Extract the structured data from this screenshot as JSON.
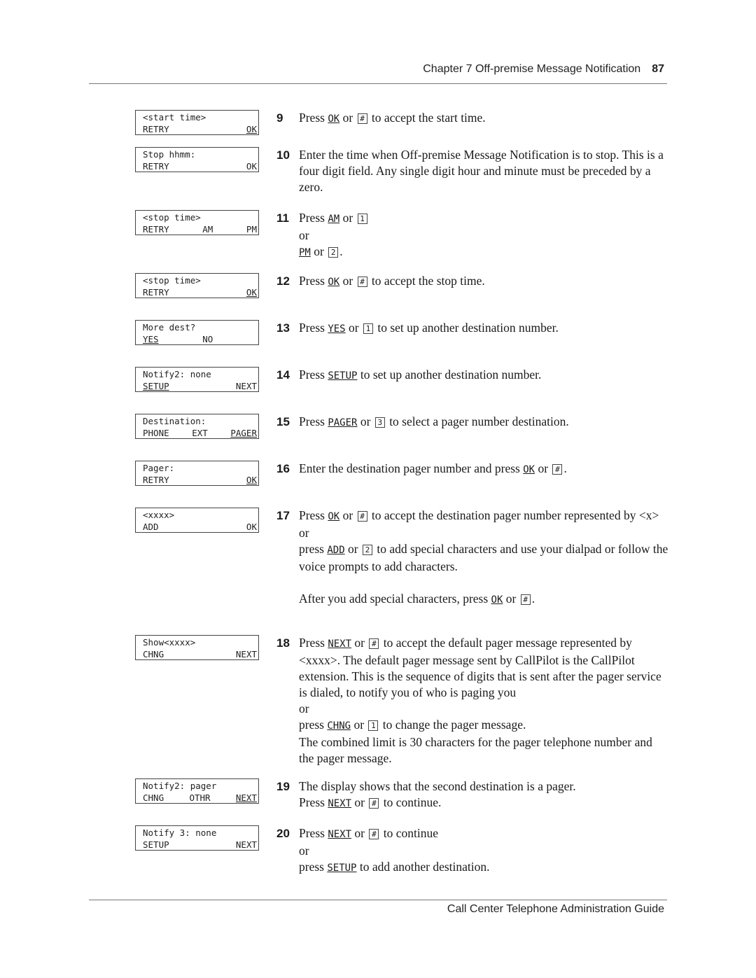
{
  "header": {
    "chapter": "Chapter 7  Off-premise Message Notification",
    "page_number": "87"
  },
  "footer": {
    "title": "Call Center Telephone Administration Guide"
  },
  "displays": [
    {
      "line1": "<start time>",
      "line2": [
        "RETRY",
        "",
        "OK"
      ],
      "underlined": [
        2
      ]
    },
    {
      "line1": "Stop hhmm:",
      "line2": [
        "RETRY",
        "",
        "OK"
      ],
      "underlined": []
    },
    {
      "line1": "<stop time>",
      "line2": [
        "RETRY",
        "AM",
        "PM"
      ],
      "underlined": []
    },
    {
      "line1": "<stop time>",
      "line2": [
        "RETRY",
        "",
        "OK"
      ],
      "underlined": [
        2
      ]
    },
    {
      "line1": "More dest?",
      "line2": [
        "YES",
        "NO",
        ""
      ],
      "underlined": [
        0
      ]
    },
    {
      "line1": "Notify2: none",
      "line2": [
        "SETUP",
        "",
        "NEXT"
      ],
      "underlined": [
        0
      ]
    },
    {
      "line1": "Destination:",
      "line2": [
        "PHONE",
        "EXT",
        "PAGER"
      ],
      "underlined": [
        2
      ]
    },
    {
      "line1": "Pager:",
      "line2": [
        "RETRY",
        "",
        "OK"
      ],
      "underlined": [
        2
      ]
    },
    {
      "line1": "<xxxx>",
      "line2": [
        "ADD",
        "",
        "OK"
      ],
      "underlined": []
    },
    {
      "line1": "Show<xxxx>",
      "line2": [
        "CHNG",
        "",
        "NEXT"
      ],
      "underlined": []
    },
    {
      "line1": "Notify2: pager",
      "line2": [
        "CHNG",
        "OTHR",
        "NEXT"
      ],
      "underlined": [
        2
      ]
    },
    {
      "line1": "Notify 3: none",
      "line2": [
        "SETUP",
        "",
        "NEXT"
      ],
      "underlined": []
    }
  ],
  "steps": {
    "s9": {
      "num": "9",
      "t1": "Press",
      "sk1": "OK",
      "t2": "or",
      "k1": "#",
      "t3": "to accept the start time."
    },
    "s10": {
      "num": "10",
      "text": "Enter the time when Off-premise Message Notification is to stop. This is a four digit field. Any single digit hour and minute must be preceded by a zero."
    },
    "s11": {
      "num": "11",
      "t1": "Press",
      "sk1": "AM",
      "t2": "or",
      "k1": "1",
      "or": "or",
      "sk2": "PM",
      "t3": "or",
      "k2": "2",
      "t4": "."
    },
    "s12": {
      "num": "12",
      "t1": "Press",
      "sk1": "OK",
      "t2": "or",
      "k1": "#",
      "t3": "to accept the stop time."
    },
    "s13": {
      "num": "13",
      "t1": "Press",
      "sk1": "YES",
      "t2": "or",
      "k1": "1",
      "t3": "to set up another destination number."
    },
    "s14": {
      "num": "14",
      "t1": "Press",
      "sk1": "SETUP",
      "t2": "to set up another destination number."
    },
    "s15": {
      "num": "15",
      "t1": "Press",
      "sk1": "PAGER",
      "t2": "or",
      "k1": "3",
      "t3": "to select a pager number destination."
    },
    "s16": {
      "num": "16",
      "t1": "Enter the destination pager number and press",
      "sk1": "OK",
      "t2": "or",
      "k1": "#",
      "t3": "."
    },
    "s17": {
      "num": "17",
      "t1": "Press",
      "sk1": "OK",
      "t2": "or",
      "k1": "#",
      "t3": "to accept the destination pager number represented by <x>",
      "or": "or",
      "t4": "press",
      "sk2": "ADD",
      "t5": "or",
      "k2": "2",
      "t6": "to add special characters and use your dialpad or follow the voice prompts to add characters.",
      "t7": "After you add special characters, press",
      "sk3": "OK",
      "t8": "or",
      "k3": "#",
      "t9": "."
    },
    "s18": {
      "num": "18",
      "t1": "Press",
      "sk1": "NEXT",
      "t2": "or",
      "k1": "#",
      "t3": "to accept the default pager message represented by <xxxx>. The default pager message sent by CallPilot is the CallPilot extension. This is the sequence of digits that is sent after the pager service is dialed, to notify you of who is paging you",
      "or": "or",
      "t4": "press",
      "sk2": "CHNG",
      "t5": "or",
      "k2": "1",
      "t6": "to change the pager message.",
      "t7": "The combined limit is 30 characters for the pager telephone number and the pager message."
    },
    "s19": {
      "num": "19",
      "t1": "The display shows that the second destination is a pager.",
      "t2": "Press",
      "sk1": "NEXT",
      "t3": "or",
      "k1": "#",
      "t4": "to continue."
    },
    "s20": {
      "num": "20",
      "t1": "Press",
      "sk1": "NEXT",
      "t2": "or",
      "k1": "#",
      "t3": "to continue",
      "or": "or",
      "t4": "press",
      "sk2": "SETUP",
      "t5": "to add another destination."
    }
  }
}
